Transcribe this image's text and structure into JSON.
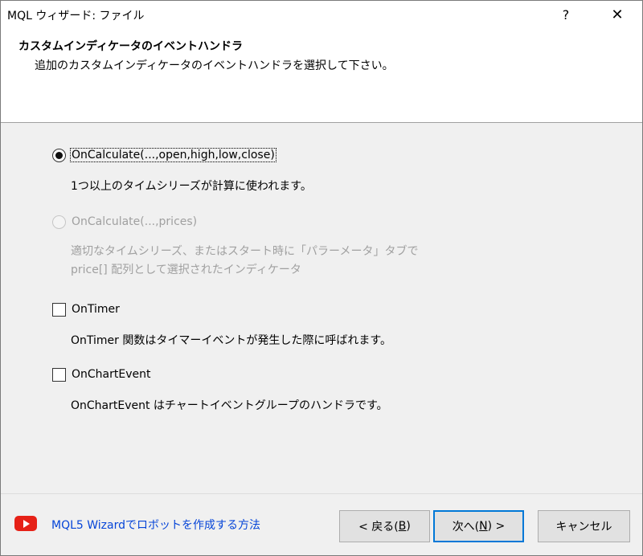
{
  "window": {
    "title": "MQL ウィザード: ファイル",
    "help_glyph": "?",
    "close_glyph": "✕"
  },
  "header": {
    "title": "カスタムインディケータのイベントハンドラ",
    "subtitle": "追加のカスタムインディケータのイベントハンドラを選択して下さい。"
  },
  "options": [
    {
      "label": "OnCalculate(...,open,high,low,close)",
      "type": "radio",
      "checked": true,
      "enabled": true,
      "description": [
        "1つ以上のタイムシリーズが計算に使われます。"
      ]
    },
    {
      "label": "OnCalculate(...,prices)",
      "type": "radio",
      "checked": false,
      "enabled": false,
      "description": [
        "適切なタイムシリーズ、またはスタート時に「パラーメータ」タブで",
        "price[] 配列として選択されたインディケータ"
      ]
    },
    {
      "label": "OnTimer",
      "type": "checkbox",
      "checked": false,
      "enabled": true,
      "description": [
        "OnTimer 関数はタイマーイベントが発生した際に呼ばれます。"
      ]
    },
    {
      "label": "OnChartEvent",
      "type": "checkbox",
      "checked": false,
      "enabled": true,
      "description": [
        "OnChartEvent はチャートイベントグループのハンドラです。"
      ]
    }
  ],
  "footer": {
    "link_text": "MQL5 Wizardでロボットを作成する方法",
    "back": {
      "prefix": "< 戻る(",
      "mnemonic": "B",
      "suffix": ")"
    },
    "next": {
      "prefix": "次へ(",
      "mnemonic": "N",
      "suffix": ") >"
    },
    "cancel_label": "キャンセル"
  },
  "colors": {
    "link": "#0645d8",
    "default_button_border": "#0078d7",
    "youtube_red": "#e62117"
  }
}
